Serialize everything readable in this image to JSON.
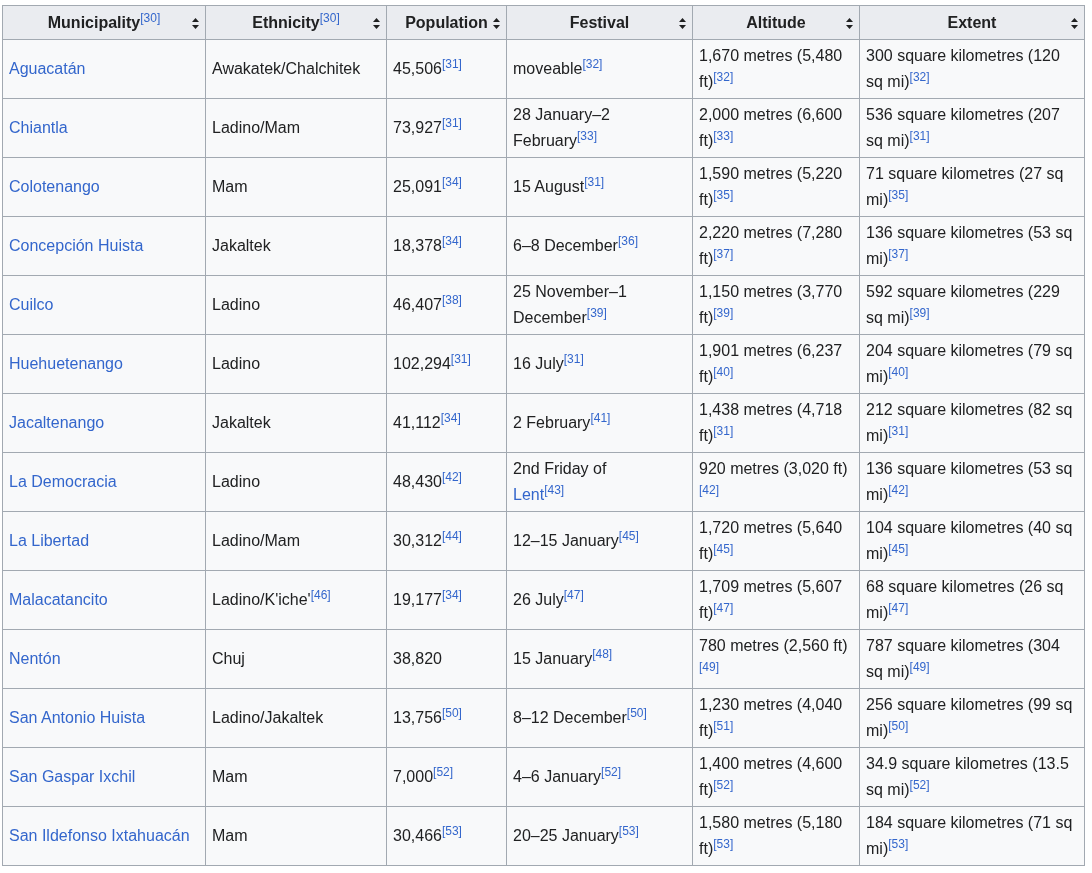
{
  "table": {
    "columns": [
      "Municipality$^{[30]}$",
      "Ethnicity$^{[30]}$",
      "Population",
      "Festival",
      "Altitude",
      "Extent"
    ],
    "rows": [
      {
        "municipality": "Aguacatán",
        "ethnicity": "Awakatek/Chalchitek",
        "population": "45,506$^{[31]}$",
        "festival": "moveable$^{[32]}$",
        "altitude": "1,670 metres (5,480 ft)$^{[32]}$",
        "extent": "300 square kilometres (120 sq mi)$^{[32]}$"
      },
      {
        "municipality": "Chiantla",
        "ethnicity": "Ladino/Mam",
        "population": "73,927$^{[31]}$",
        "festival": "28 January–2 February$^{[33]}$",
        "altitude": "2,000 metres (6,600 ft)$^{[33]}$",
        "extent": "536 square kilometres (207 sq mi)$^{[31]}$"
      },
      {
        "municipality": "Colotenango",
        "ethnicity": "Mam",
        "population": "25,091$^{[34]}$",
        "festival": "15 August$^{[31]}$",
        "altitude": "1,590 metres (5,220 ft)$^{[35]}$",
        "extent": "71 square kilometres (27 sq mi)$^{[35]}$"
      },
      {
        "municipality": "Concepción Huista",
        "ethnicity": "Jakaltek",
        "population": "18,378$^{[34]}$",
        "festival": "6–8 December$^{[36]}$",
        "altitude": "2,220 metres (7,280 ft)$^{[37]}$",
        "extent": "136 square kilometres (53 sq mi)$^{[37]}$"
      },
      {
        "municipality": "Cuilco",
        "ethnicity": "Ladino",
        "population": "46,407$^{[38]}$",
        "festival": "25 November–1 December$^{[39]}$",
        "altitude": "1,150 metres (3,770 ft)$^{[39]}$",
        "extent": "592 square kilometres (229 sq mi)$^{[39]}$"
      },
      {
        "municipality": "Huehuetenango",
        "ethnicity": "Ladino",
        "population": "102,294$^{[31]}$",
        "festival": "16 July$^{[31]}$",
        "altitude": "1,901 metres (6,237 ft)$^{[40]}$",
        "extent": "204 square kilometres (79 sq mi)$^{[40]}$"
      },
      {
        "municipality": "Jacaltenango",
        "ethnicity": "Jakaltek",
        "population": "41,112$^{[34]}$",
        "festival": "2 February$^{[41]}$",
        "altitude": "1,438 metres (4,718 ft)$^{[31]}$",
        "extent": "212 square kilometres (82 sq mi)$^{[31]}$"
      },
      {
        "municipality": "La Democracia",
        "ethnicity": "Ladino",
        "population": "48,430$^{[42]}$",
        "festival": "2nd Friday of",
        "festival_link": "Lent$^{[43]}$",
        "altitude": "920 metres (3,020 ft)$^{[42]}$",
        "extent": "136 square kilometres (53 sq mi)$^{[42]}$"
      },
      {
        "municipality": "La Libertad",
        "ethnicity": "Ladino/Mam",
        "population": "30,312$^{[44]}$",
        "festival": "12–15 January$^{[45]}$",
        "altitude": "1,720 metres (5,640 ft)$^{[45]}$",
        "extent": "104 square kilometres (40 sq mi)$^{[45]}$"
      },
      {
        "municipality": "Malacatancito",
        "ethnicity": "Ladino/K'iche'$^{[46]}$",
        "population": "19,177$^{[34]}$",
        "festival": "26 July$^{[47]}$",
        "altitude": "1,709 metres (5,607 ft)$^{[47]}$",
        "extent": "68 square kilometres (26 sq mi)$^{[47]}$"
      },
      {
        "municipality": "Nentón",
        "ethnicity": "Chuj",
        "population": "38,820",
        "festival": "15 January$^{[48]}$",
        "altitude": "780 metres (2,560 ft)$^{[49]}$",
        "extent": "787 square kilometres (304 sq mi)$^{[49]}$"
      },
      {
        "municipality": "San Antonio Huista",
        "ethnicity": "Ladino/Jakaltek",
        "population": "13,756$^{[50]}$",
        "festival": "8–12 December$^{[50]}$",
        "altitude": "1,230 metres (4,040 ft)$^{[51]}$",
        "extent": "256 square kilometres (99 sq mi)$^{[50]}$"
      },
      {
        "municipality": "San Gaspar Ixchil",
        "ethnicity": "Mam",
        "population": "7,000$^{[52]}$",
        "festival": "4–6 January$^{[52]}$",
        "altitude": "1,400 metres (4,600 ft)$^{[52]}$",
        "extent": "34.9 square kilometres (13.5 sq mi)$^{[52]}$"
      },
      {
        "municipality": "San Ildefonso Ixtahuacán",
        "ethnicity": "Mam",
        "population": "30,466$^{[53]}$",
        "festival": "20–25 January$^{[53]}$",
        "altitude": "1,580 metres (5,180 ft)$^{[53]}$",
        "extent": "184 square kilometres (71 sq mi)$^{[53]}$"
      }
    ]
  }
}
